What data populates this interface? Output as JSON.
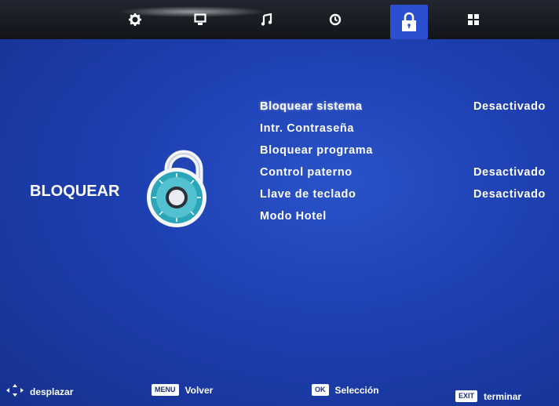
{
  "top_menu": {
    "icons": [
      {
        "name": "picture-settings-icon"
      },
      {
        "name": "screen-icon"
      },
      {
        "name": "music-note-icon"
      },
      {
        "name": "clock-icon"
      },
      {
        "name": "lock-icon"
      },
      {
        "name": "grid-icon"
      }
    ],
    "active_index": 4
  },
  "section": {
    "title": "BLOQUEAR"
  },
  "menu": {
    "items": [
      {
        "label": "Bloquear sistema",
        "value": "Desactivado"
      },
      {
        "label": "Intr. Contraseña",
        "value": ""
      },
      {
        "label": "Bloquear programa",
        "value": ""
      },
      {
        "label": "Control paterno",
        "value": "Desactivado"
      },
      {
        "label": "Llave de teclado",
        "value": "Desactivado"
      },
      {
        "label": "Modo Hotel",
        "value": ""
      }
    ]
  },
  "footer": {
    "move_label": "desplazar",
    "menu_key": "MENU",
    "back_label": "Volver",
    "ok_key": "OK",
    "select_label": "Selección",
    "exit_key": "EXIT",
    "exit_label": "terminar"
  },
  "colors": {
    "background": "#1d3fb0",
    "topbar": "#1a1c22",
    "active_tab": "#2b4fd0",
    "text": "#ffffff"
  }
}
